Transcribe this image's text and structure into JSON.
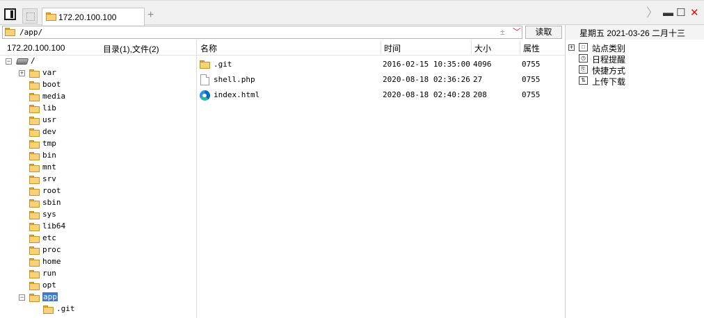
{
  "tabs": [
    {
      "label": "172.20.100.100",
      "active": true
    }
  ],
  "tabbar": {
    "add_glyph": "+"
  },
  "window_controls": {
    "chevron": "〉",
    "minimize": "▬",
    "maximize": "☐",
    "close": "✕"
  },
  "address": {
    "path": "/app/",
    "pin_glyph": "±",
    "dropdown_glyph": "﹀",
    "read_button": "读取"
  },
  "date": {
    "text": "星期五  2021-03-26  二月十三"
  },
  "left_header": {
    "host": "172.20.100.100",
    "counts": "目录(1),文件(2)"
  },
  "columns": {
    "name": "名称",
    "time": "时间",
    "size": "大小",
    "attr": "属性"
  },
  "tree": {
    "root": {
      "label": "/",
      "icon": "drive-icon",
      "expander": "−"
    },
    "items": [
      {
        "label": "var",
        "expander": "+"
      },
      {
        "label": "boot"
      },
      {
        "label": "media"
      },
      {
        "label": "lib"
      },
      {
        "label": "usr"
      },
      {
        "label": "dev"
      },
      {
        "label": "tmp"
      },
      {
        "label": "bin"
      },
      {
        "label": "mnt"
      },
      {
        "label": "srv"
      },
      {
        "label": "root"
      },
      {
        "label": "sbin"
      },
      {
        "label": "sys"
      },
      {
        "label": "lib64"
      },
      {
        "label": "etc"
      },
      {
        "label": "proc"
      },
      {
        "label": "home"
      },
      {
        "label": "run"
      },
      {
        "label": "opt"
      },
      {
        "label": "app",
        "expander": "−",
        "selected": true
      }
    ],
    "app_children": [
      {
        "label": ".git"
      }
    ]
  },
  "files": [
    {
      "name": ".git",
      "icon": "folder-icon",
      "time": "2016-02-15 10:35:00",
      "size": "4096",
      "attr": "0755"
    },
    {
      "name": "shell.php",
      "icon": "document-icon",
      "time": "2020-08-18 02:36:26",
      "size": "27",
      "attr": "0755"
    },
    {
      "name": "index.html",
      "icon": "edge-browser-icon",
      "time": "2020-08-18 02:40:28",
      "size": "208",
      "attr": "0755"
    }
  ],
  "sidebar": {
    "items": [
      {
        "label": "站点类别",
        "icon": "category-icon",
        "expander": "+"
      },
      {
        "label": "日程提醒",
        "icon": "reminder-icon"
      },
      {
        "label": "快捷方式",
        "icon": "shortcut-icon"
      },
      {
        "label": "上传下载",
        "icon": "transfer-icon"
      }
    ]
  },
  "colors": {
    "selection": "#3a7bd5",
    "folder": "#f6d27a",
    "close": "#dd1111"
  }
}
